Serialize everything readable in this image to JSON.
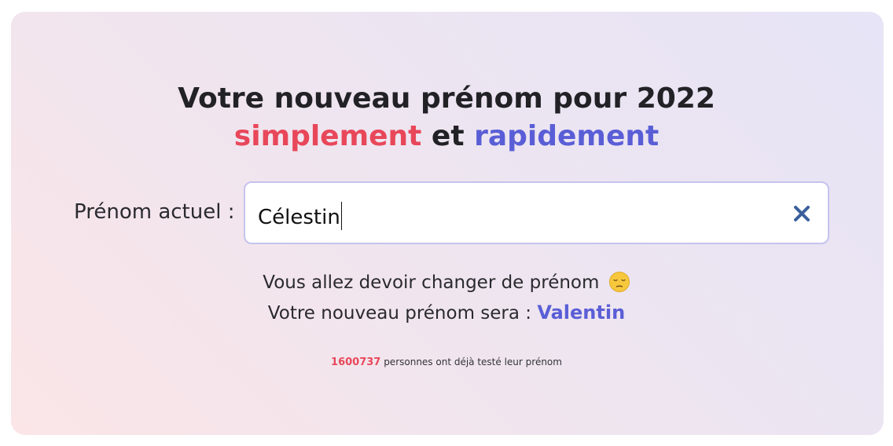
{
  "headline": {
    "line1": "Votre nouveau prénom pour 2022",
    "word_simply": "simplement",
    "connector": "et",
    "word_quickly": "rapidement"
  },
  "form": {
    "label": "Prénom actuel :",
    "input_value": "Célestin",
    "clear_icon": "close-icon"
  },
  "result": {
    "message": "Vous allez devoir changer de prénom",
    "message_icon": "pensive-face-emoji",
    "new_name_prefix": "Votre nouveau prénom sera :",
    "new_name": "Valentin"
  },
  "stats": {
    "count": "1600737",
    "suffix": "personnes ont déjà testé leur prénom"
  },
  "colors": {
    "accent_red": "#e8475a",
    "accent_blue": "#5a5ed6",
    "input_border": "#c5c3ee",
    "clear_icon": "#3a5f9c"
  }
}
